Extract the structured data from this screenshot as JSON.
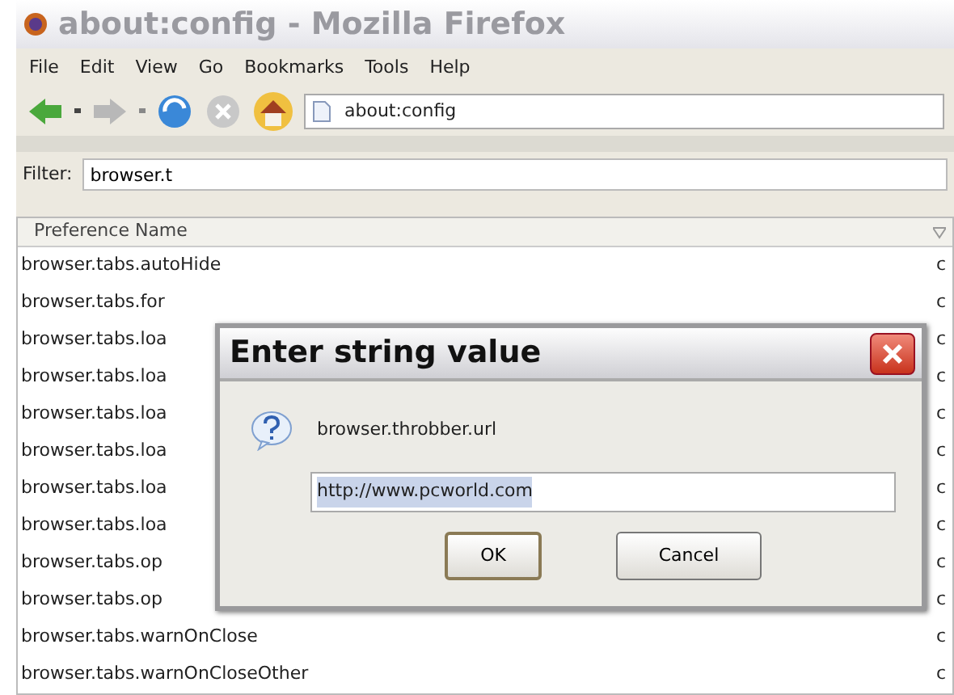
{
  "window": {
    "title": "about:config - Mozilla Firefox"
  },
  "menu": [
    "File",
    "Edit",
    "View",
    "Go",
    "Bookmarks",
    "Tools",
    "Help"
  ],
  "address": {
    "value": "about:config"
  },
  "filter": {
    "label": "Filter:",
    "value": "browser.t"
  },
  "table": {
    "columns": [
      "Preference Name"
    ],
    "rows": [
      {
        "name": "browser.tabs.autoHide",
        "column_2": "c"
      },
      {
        "name": "browser.tabs.for",
        "column_2": "c"
      },
      {
        "name": "browser.tabs.loa",
        "column_2": "c"
      },
      {
        "name": "browser.tabs.loa",
        "column_2": "c"
      },
      {
        "name": "browser.tabs.loa",
        "column_2": "c"
      },
      {
        "name": "browser.tabs.loa",
        "column_2": "c"
      },
      {
        "name": "browser.tabs.loa",
        "column_2": "c"
      },
      {
        "name": "browser.tabs.loa",
        "column_2": "c"
      },
      {
        "name": "browser.tabs.op",
        "column_2": "c"
      },
      {
        "name": "browser.tabs.op",
        "column_2": "c"
      },
      {
        "name": "browser.tabs.warnOnClose",
        "column_2": "c"
      },
      {
        "name": "browser.tabs.warnOnCloseOther",
        "column_2": "c"
      }
    ]
  },
  "dialog": {
    "title": "Enter string value",
    "message": "browser.throbber.url",
    "value": "http://www.pcworld.com",
    "value_selected": true,
    "buttons": [
      {
        "label": "OK",
        "default": true
      },
      {
        "label": "Cancel",
        "default": false
      }
    ]
  }
}
